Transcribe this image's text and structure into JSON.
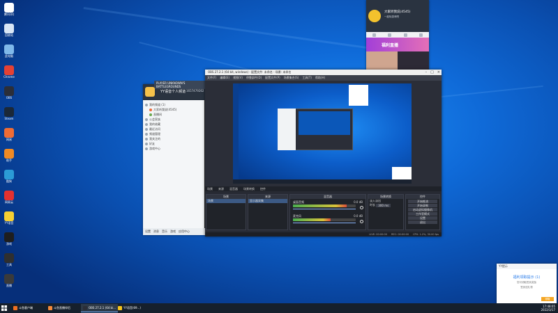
{
  "desktop": {
    "icons": [
      {
        "label": "腾讯QQ",
        "color": "#ffffff"
      },
      {
        "label": "回收站",
        "color": "#d9e6f5"
      },
      {
        "label": "此电脑",
        "color": "#7fb8ea"
      },
      {
        "label": "Chrome",
        "color": "#e44134"
      },
      {
        "label": "OBS",
        "color": "#2b2e38"
      },
      {
        "label": "Steam",
        "color": "#1b2838"
      },
      {
        "label": "网易",
        "color": "#ef6c35"
      },
      {
        "label": "助手",
        "color": "#f08a24"
      },
      {
        "label": "酷狗",
        "color": "#2b9bd6"
      },
      {
        "label": "网易云",
        "color": "#e5312f"
      },
      {
        "label": "YY语音",
        "color": "#f7d033"
      },
      {
        "label": "游戏",
        "color": "#1e1e1e"
      },
      {
        "label": "工具",
        "color": "#2f2f2f"
      },
      {
        "label": "直播",
        "color": "#3a3a3a"
      }
    ]
  },
  "taskbar": {
    "items": [
      {
        "label": "斗鱼客户端",
        "color": "#f07022"
      },
      {
        "label": "斗鱼直播伴侣",
        "color": "#f58a3a"
      },
      {
        "label": "OBS 27.2.1 (64 bi...",
        "color": "#2b2e38"
      },
      {
        "label": "YY语音(69...)",
        "color": "#f5c31c"
      }
    ],
    "time": "17:48:05",
    "date": "2022/3/17"
  },
  "qq": {
    "banner": "PLAYER UNKNOWN'S BATTLEGROUNDS",
    "name": "YY语音个人频道",
    "number": "1657479262",
    "rows": [
      {
        "label": "我的频道 (1)",
        "dot": "#9aa6b2"
      },
      {
        "label": "大家听我说(4545)",
        "dot": "#ec6a3a"
      },
      {
        "label": "直播间",
        "dot": "#6aa84f"
      },
      {
        "label": "公会家族",
        "dot": "#9aa6b2"
      },
      {
        "label": "我的收藏",
        "dot": "#9aa6b2"
      },
      {
        "label": "最近访问",
        "dot": "#9aa6b2"
      },
      {
        "label": "频道管理",
        "dot": "#9aa6b2"
      },
      {
        "label": "我关注的",
        "dot": "#9aa6b2"
      },
      {
        "label": "好友",
        "dot": "#9aa6b2"
      },
      {
        "label": "游戏中心",
        "dot": "#9aa6b2"
      }
    ],
    "footer": [
      "设置",
      "消息",
      "音乐",
      "游戏",
      "应用中心"
    ]
  },
  "obs": {
    "title": "OBS 27.2.1 (64 bit, windows) - 配置文件: 未命名 - 场景: 未命名",
    "menu": [
      "文件(F)",
      "编辑(E)",
      "视图(V)",
      "停靠部件(D)",
      "配置文件(P)",
      "场景集合(S)",
      "工具(T)",
      "帮助(H)"
    ],
    "dock_tabs": [
      "场景",
      "来源",
      "混音器",
      "场景转换",
      "控件"
    ],
    "scenes": {
      "header": "场景",
      "items": [
        "场景"
      ]
    },
    "sources": {
      "header": "来源",
      "items": [
        "显示器采集"
      ]
    },
    "mixer": {
      "header": "混音器",
      "tracks": [
        {
          "label": "桌面音频",
          "db": "0.0 dB",
          "level": 0.85,
          "color": "#4caf50"
        },
        {
          "label": "麦克风",
          "db": "0.0 dB",
          "level": 0.6,
          "color": "#4caf50"
        }
      ]
    },
    "transition": {
      "header": "场景转换",
      "type": "淡入淡出",
      "duration_label": "时长",
      "duration": "300 ms"
    },
    "controls": {
      "header": "控件",
      "buttons": [
        "开始推流",
        "开始录制",
        "启动虚拟摄像机",
        "工作室模式",
        "设置",
        "退出"
      ]
    },
    "status": [
      "LIVE: 00:00:00",
      "REC: 00:00:00",
      "CPU: 1.2%, 30.00 fps"
    ]
  },
  "miniqq": {
    "name": "大家听我说(4545)",
    "subtitle": "一起玩游戏吧",
    "banner": "福利直播",
    "banner_colors": [
      "#a23fd8",
      "#e46fb7"
    ]
  },
  "popup": {
    "header": "YY提示",
    "title": "福利领取提示 (1)",
    "lines": [
      "您可领取签到奖励",
      "签到送礼物"
    ],
    "button": "领取"
  }
}
